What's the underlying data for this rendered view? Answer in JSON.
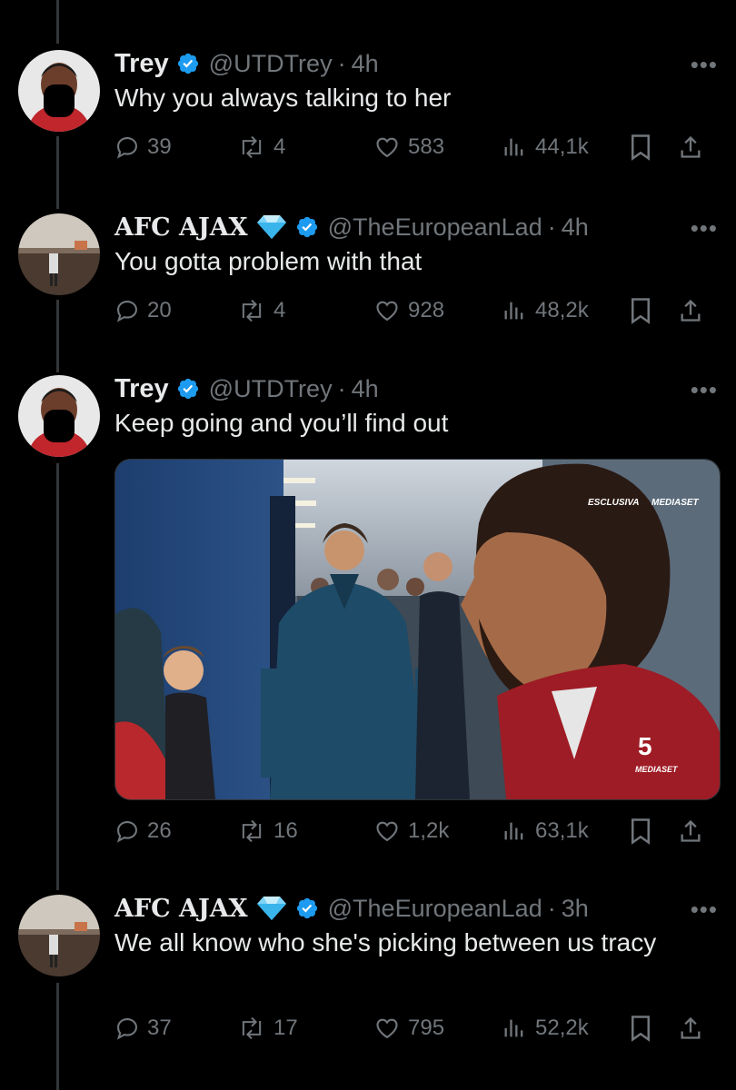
{
  "tweets": [
    {
      "name": "Trey",
      "handle": "@UTDTrey",
      "dot": "·",
      "time": "4h",
      "text": "Why you always talking to her",
      "diamond": false,
      "stats": {
        "replies": "39",
        "retweets": "4",
        "likes": "583",
        "views": "44,1k"
      }
    },
    {
      "name": "AFC AJAX",
      "handle": "@TheEuropeanLad",
      "dot": "·",
      "time": "4h",
      "text": "You gotta problem with that",
      "diamond": true,
      "stats": {
        "replies": "20",
        "retweets": "4",
        "likes": "928",
        "views": "48,2k"
      }
    },
    {
      "name": "Trey",
      "handle": "@UTDTrey",
      "dot": "·",
      "time": "4h",
      "text": "Keep going and you’ll find out",
      "diamond": false,
      "media": {
        "watermark_top": "ESCLUSIVA",
        "watermark_top_brand": "MEDIASET",
        "watermark_bottom": "MEDIASET",
        "channel": "5"
      },
      "stats": {
        "replies": "26",
        "retweets": "16",
        "likes": "1,2k",
        "views": "63,1k"
      }
    },
    {
      "name": "AFC AJAX",
      "handle": "@TheEuropeanLad",
      "dot": "·",
      "time": "3h",
      "text": "We all know who she's picking between us tracy",
      "diamond": true,
      "stats": {
        "replies": "37",
        "retweets": "17",
        "likes": "795",
        "views": "52,2k"
      }
    }
  ],
  "icons": {
    "more": "more-horizontal-icon",
    "reply": "reply-icon",
    "retweet": "retweet-icon",
    "like": "heart-icon",
    "views": "views-icon",
    "bookmark": "bookmark-icon",
    "share": "share-icon",
    "verified": "verified-badge-icon",
    "diamond": "diamond-emoji-icon"
  },
  "colors": {
    "background": "#000000",
    "text": "#e7e9ea",
    "secondary": "#71767b",
    "verified": "#1d9bf0",
    "thread_line": "#333639"
  }
}
